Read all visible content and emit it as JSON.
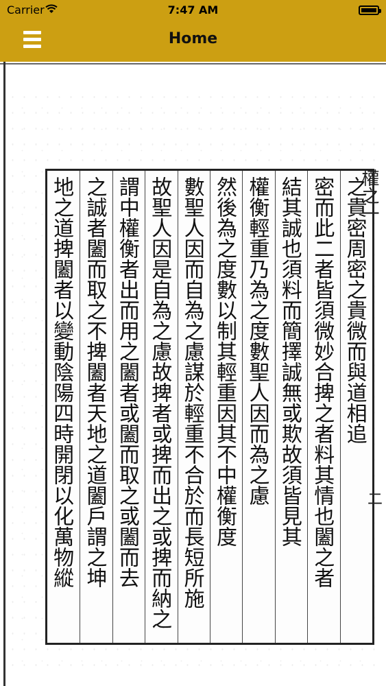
{
  "status_bar": {
    "carrier": "Carrier",
    "time": "7:47 AM",
    "wifi_icon": "wifi-icon",
    "battery_icon": "battery-icon"
  },
  "nav": {
    "title": "Home",
    "menu_icon": "hamburger-menu-icon"
  },
  "colors": {
    "header": "#cc9f12",
    "page_bg": "#ffffff",
    "ink": "#111111"
  },
  "scan": {
    "side_label": "權之一",
    "side_mark": "二",
    "columns": [
      "之貴密周密之貴微而與道相追",
      "密而此二者皆須微妙合捭之者料其情也闔之者",
      "結其誠也須料而簡擇誠無或欺故須皆見其",
      "權衡輕重乃為之度數聖人因而為之慮",
      "然後為之度數以制其輕重因其不中權衡度",
      "數聖人因而自為之慮謀於輕重不合於而長短所施",
      "故聖人因是自為之慮故捭者或捭而出之或捭而納之",
      "謂中權衡者出而用之闔者或闔而取之或闔而去",
      "之誠者闔而取之不捭闔者天地之道闔戶謂之坤",
      "地之道捭闔者以變動陰陽四時開閉以化萬物縱"
    ]
  }
}
